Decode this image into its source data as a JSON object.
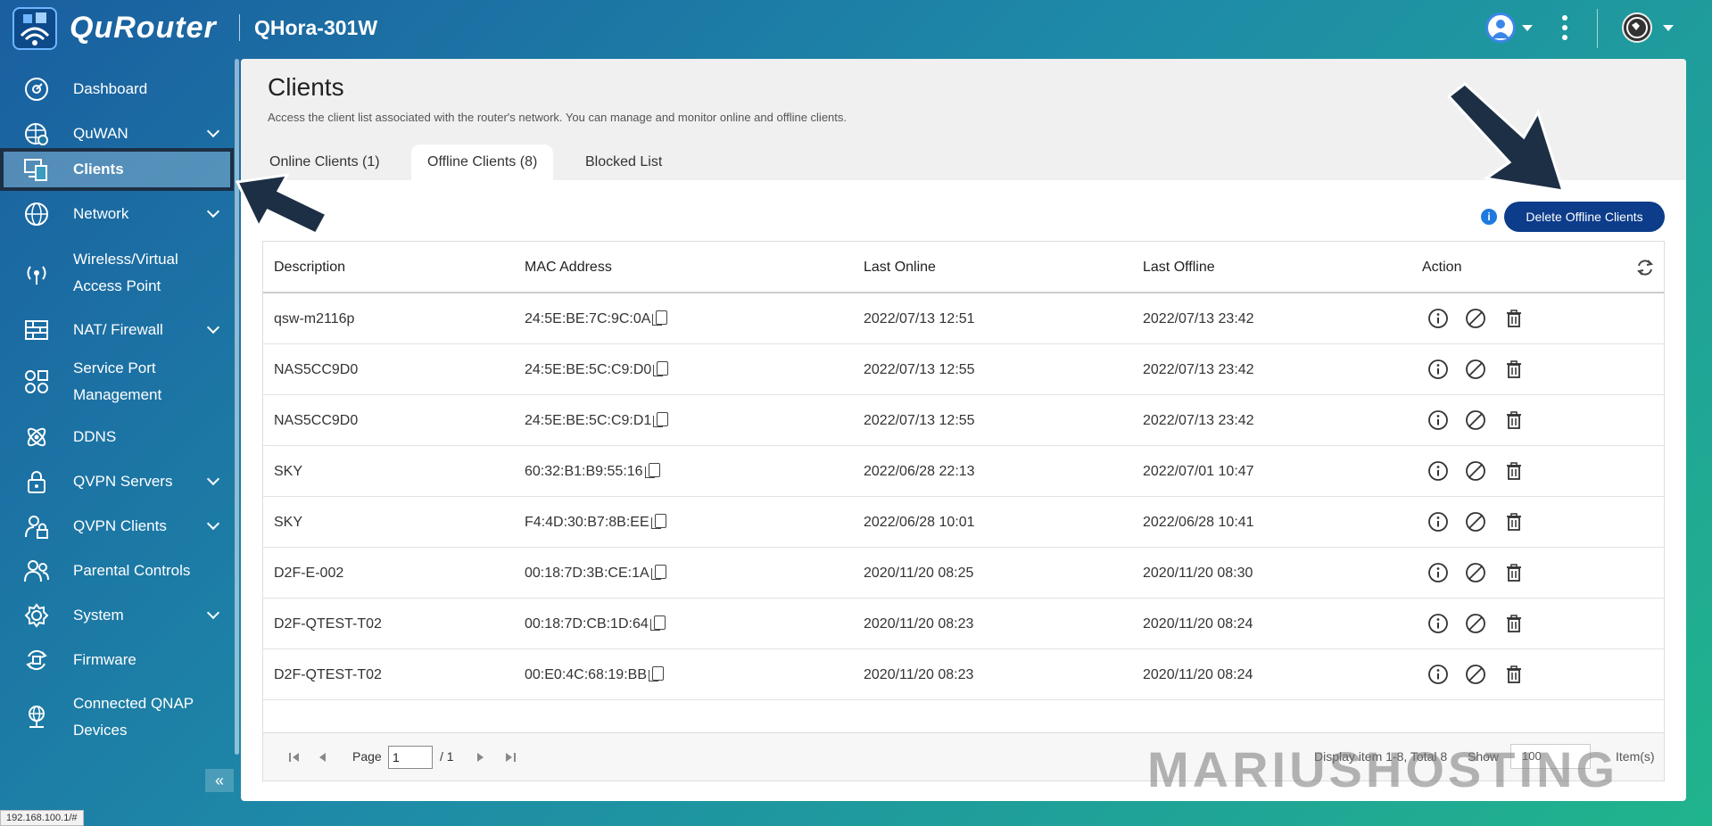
{
  "app": {
    "brand": "QuRouter",
    "model": "QHora-301W"
  },
  "sidebar": {
    "items": [
      {
        "label": "Dashboard",
        "icon": "dashboard-icon",
        "expandable": false
      },
      {
        "label": "QuWAN",
        "icon": "quwan-icon",
        "expandable": true
      },
      {
        "label": "Clients",
        "icon": "clients-icon",
        "expandable": false,
        "active": true
      },
      {
        "label": "Network",
        "icon": "globe-icon",
        "expandable": true
      },
      {
        "label": "Wireless/Virtual",
        "label2": "Access Point",
        "icon": "wireless-icon",
        "expandable": false
      },
      {
        "label": "NAT/ Firewall",
        "icon": "firewall-icon",
        "expandable": true
      },
      {
        "label": "Service Port",
        "label2": "Management",
        "icon": "service-port-icon",
        "expandable": false
      },
      {
        "label": "DDNS",
        "icon": "ddns-icon",
        "expandable": false
      },
      {
        "label": "QVPN Servers",
        "icon": "vpn-server-icon",
        "expandable": true
      },
      {
        "label": "QVPN Clients",
        "icon": "vpn-client-icon",
        "expandable": true
      },
      {
        "label": "Parental Controls",
        "icon": "parental-controls-icon",
        "expandable": false
      },
      {
        "label": "System",
        "icon": "system-icon",
        "expandable": true
      },
      {
        "label": "Firmware",
        "icon": "firmware-icon",
        "expandable": false
      },
      {
        "label": "Connected QNAP",
        "label2": "Devices",
        "icon": "qnap-devices-icon",
        "expandable": false
      }
    ],
    "collapse_glyph": "«"
  },
  "main": {
    "title": "Clients",
    "description": "Access the client list associated with the router's network. You can manage and monitor online and offline clients.",
    "tabs": [
      {
        "label": "Online Clients (1)",
        "active": false
      },
      {
        "label": "Offline Clients (8)",
        "active": true
      },
      {
        "label": "Blocked List",
        "active": false
      }
    ],
    "info_glyph": "i",
    "delete_button": "Delete Offline Clients",
    "table": {
      "headers": [
        "Description",
        "MAC Address",
        "Last Online",
        "Last Offline",
        "Action"
      ],
      "rows": [
        {
          "description": "qsw-m2116p",
          "mac": "24:5E:BE:7C:9C:0A",
          "last_online": "2022/07/13 12:51",
          "last_offline": "2022/07/13 23:42"
        },
        {
          "description": "NAS5CC9D0",
          "mac": "24:5E:BE:5C:C9:D0",
          "last_online": "2022/07/13 12:55",
          "last_offline": "2022/07/13 23:42"
        },
        {
          "description": "NAS5CC9D0",
          "mac": "24:5E:BE:5C:C9:D1",
          "last_online": "2022/07/13 12:55",
          "last_offline": "2022/07/13 23:42"
        },
        {
          "description": "SKY",
          "mac": "60:32:B1:B9:55:16",
          "last_online": "2022/06/28 22:13",
          "last_offline": "2022/07/01 10:47"
        },
        {
          "description": "SKY",
          "mac": "F4:4D:30:B7:8B:EE",
          "last_online": "2022/06/28 10:01",
          "last_offline": "2022/06/28 10:41"
        },
        {
          "description": "D2F-E-002",
          "mac": "00:18:7D:3B:CE:1A",
          "last_online": "2020/11/20 08:25",
          "last_offline": "2020/11/20 08:30"
        },
        {
          "description": "D2F-QTEST-T02",
          "mac": "00:18:7D:CB:1D:64",
          "last_online": "2020/11/20 08:23",
          "last_offline": "2020/11/20 08:24"
        },
        {
          "description": "D2F-QTEST-T02",
          "mac": "00:E0:4C:68:19:BB",
          "last_online": "2020/11/20 08:23",
          "last_offline": "2020/11/20 08:24"
        }
      ]
    },
    "pager": {
      "page_label": "Page",
      "page_value": "1",
      "page_total": "/ 1",
      "display_text": "Display item 1-8, Total 8",
      "show_label": "Show",
      "show_value": "100",
      "items_label": "Item(s)"
    }
  },
  "watermark": "MARIUSHOSTING",
  "status_url": "192.168.100.1/#",
  "colors": {
    "primary": "#0c3c8a",
    "info": "#1d7be0",
    "arrow": "#1c2f45"
  }
}
